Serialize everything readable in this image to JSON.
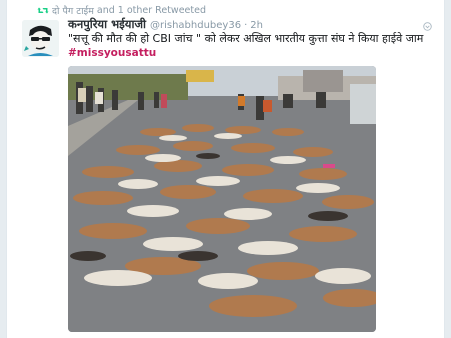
{
  "retweet_context": {
    "icon": "retweet-icon",
    "actor": "दो पैग टाईम",
    "rest": "and 1 other Retweeted"
  },
  "tweet": {
    "avatar_icon": "avatar",
    "display_name": "कनपुरिया भईयाजी",
    "handle": "@rishabhdubey36",
    "separator": "·",
    "time": "2h",
    "text_line1": "\"सत्तू की मौत की हो CBI जांच \" को लेकर अखिल भारतीय कुत्ता संघ ने किया हाईवे जाम",
    "hashtag": "#missyousattu",
    "menu_icon": "caret-down-icon",
    "media": {
      "description_icon": "photo-image",
      "sign_text": ""
    }
  },
  "colors": {
    "accent_link": "#c41e5f",
    "muted": "#8899a6",
    "retweet_green": "#19cf86"
  }
}
